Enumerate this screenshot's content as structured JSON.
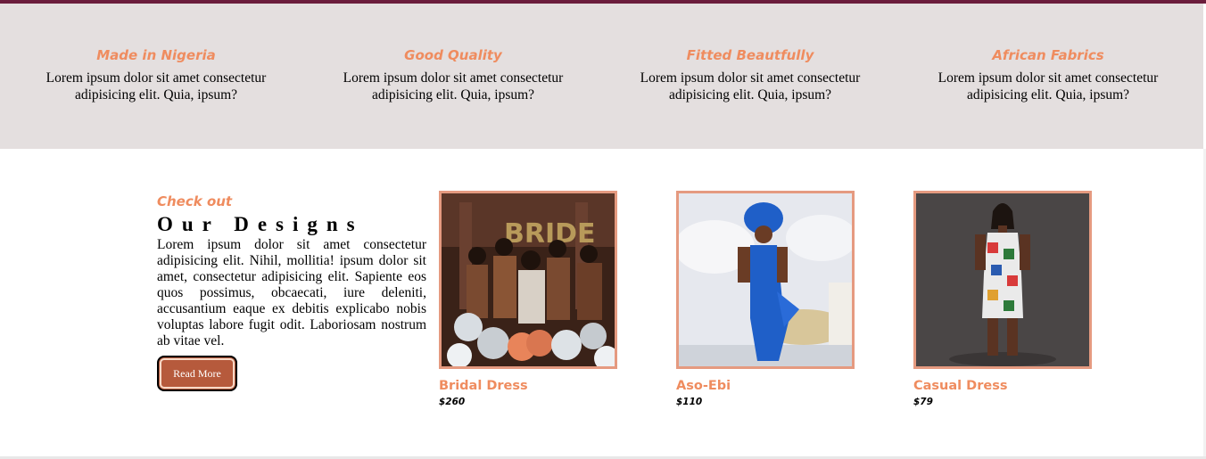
{
  "features": [
    {
      "title": "Made in Nigeria",
      "text": "Lorem ipsum dolor sit amet consectetur adipisicing elit. Quia, ipsum?"
    },
    {
      "title": "Good Quality",
      "text": "Lorem ipsum dolor sit amet consectetur adipisicing elit. Quia, ipsum?"
    },
    {
      "title": "Fitted Beautfully",
      "text": "Lorem ipsum dolor sit amet consectetur adipisicing elit. Quia, ipsum?"
    },
    {
      "title": "African Fabrics",
      "text": "Lorem ipsum dolor sit amet consectetur adipisicing elit. Quia, ipsum?"
    }
  ],
  "designs": {
    "kicker": "Check out",
    "title": "Our Designs",
    "text": "Lorem ipsum dolor sit amet consectetur adipisicing elit. Nihil, mollitia! ipsum dolor sit amet, consectetur adipisicing elit. Sapiente eos quos possimus, obcaecati, iure deleniti, accusantium eaque ex debitis explicabo nobis voluptas labore fugit odit. Laboriosam nostrum ab vitae vel.",
    "button_label": "Read More"
  },
  "products": [
    {
      "name": "Bridal Dress",
      "price": "$260"
    },
    {
      "name": "Aso-Ebi",
      "price": "$110"
    },
    {
      "name": "Casual Dress",
      "price": "$79"
    }
  ],
  "colors": {
    "accent": "#ef8c5f",
    "feature_band": "#e4dfdf",
    "button": "#b65a3c",
    "photo_border": "#e59a80",
    "top_strip": "#6b1d3c"
  }
}
